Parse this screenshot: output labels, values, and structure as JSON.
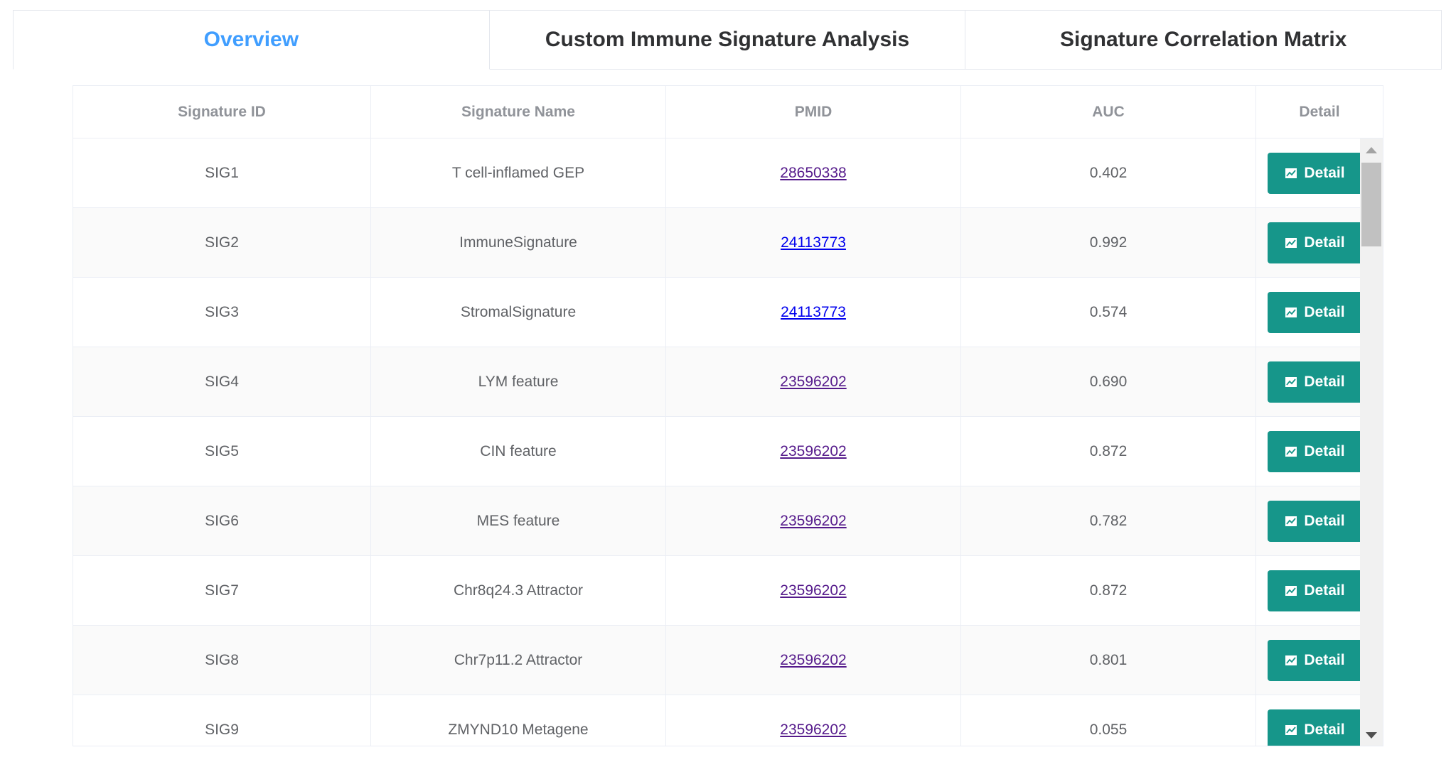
{
  "tabs": [
    {
      "label": "Overview",
      "active": true
    },
    {
      "label": "Custom Immune Signature Analysis",
      "active": false
    },
    {
      "label": "Signature Correlation Matrix",
      "active": false
    }
  ],
  "table": {
    "headers": [
      "Signature ID",
      "Signature Name",
      "PMID",
      "AUC",
      "Detail"
    ],
    "rows": [
      {
        "id": "SIG1",
        "name": "T cell-inflamed GEP",
        "pmid": "28650338",
        "auc": "0.402",
        "detail": "Detail",
        "visited": true
      },
      {
        "id": "SIG2",
        "name": "ImmuneSignature",
        "pmid": "24113773",
        "auc": "0.992",
        "detail": "Detail",
        "visited": false
      },
      {
        "id": "SIG3",
        "name": "StromalSignature",
        "pmid": "24113773",
        "auc": "0.574",
        "detail": "Detail",
        "visited": false
      },
      {
        "id": "SIG4",
        "name": "LYM feature",
        "pmid": "23596202",
        "auc": "0.690",
        "detail": "Detail",
        "visited": true
      },
      {
        "id": "SIG5",
        "name": "CIN feature",
        "pmid": "23596202",
        "auc": "0.872",
        "detail": "Detail",
        "visited": true
      },
      {
        "id": "SIG6",
        "name": "MES feature",
        "pmid": "23596202",
        "auc": "0.782",
        "detail": "Detail",
        "visited": true
      },
      {
        "id": "SIG7",
        "name": "Chr8q24.3 Attractor",
        "pmid": "23596202",
        "auc": "0.872",
        "detail": "Detail",
        "visited": true
      },
      {
        "id": "SIG8",
        "name": "Chr7p11.2 Attractor",
        "pmid": "23596202",
        "auc": "0.801",
        "detail": "Detail",
        "visited": true
      },
      {
        "id": "SIG9",
        "name": "ZMYND10 Metagene",
        "pmid": "23596202",
        "auc": "0.055",
        "detail": "Detail",
        "visited": true
      }
    ]
  },
  "icons": {
    "detail_button": "line-chart-icon",
    "scroll_up": "caret-up-icon",
    "scroll_down": "caret-down-icon"
  },
  "colors": {
    "active_tab": "#409eff",
    "detail_button_bg": "#16968a",
    "visited_link": "#551a8b",
    "unvisited_link": "#0000ee"
  }
}
